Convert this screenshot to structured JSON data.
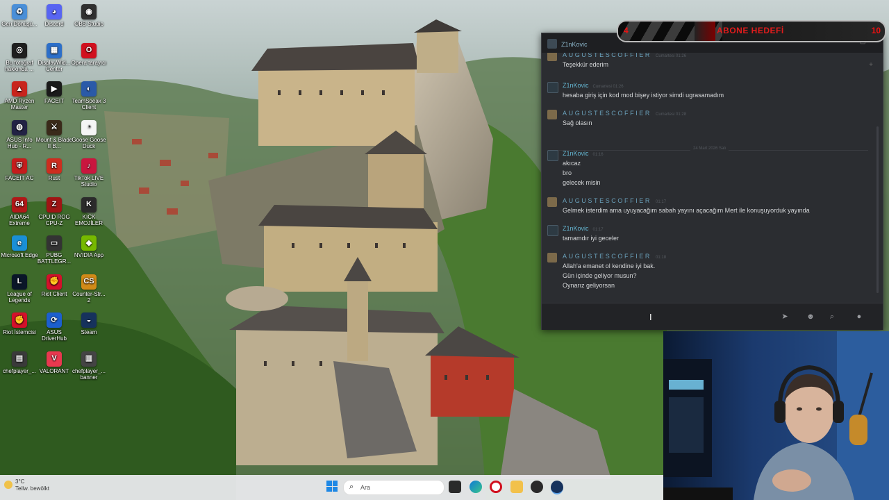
{
  "desktop": {
    "icons": [
      {
        "label": "Geri Dönüşü...",
        "color": "#4a8fd8",
        "glyph": "♻"
      },
      {
        "label": "Discord",
        "color": "#5865f2",
        "glyph": "◕"
      },
      {
        "label": "OBS Studio",
        "color": "#303030",
        "glyph": "◉"
      },
      {
        "label": "Bu fotoğraf hakkında ...",
        "color": "#1f1f1f",
        "glyph": "◎"
      },
      {
        "label": "DisplayWid... Center",
        "color": "#2d6fc9",
        "glyph": "▦"
      },
      {
        "label": "Opera tarayıcı",
        "color": "#d1101e",
        "glyph": "O"
      },
      {
        "label": "AMD Ryzen Master",
        "color": "#c8251d",
        "glyph": "▲"
      },
      {
        "label": "FACEIT",
        "color": "#1a1a1a",
        "glyph": "▶"
      },
      {
        "label": "TeamSpeak 3 Client",
        "color": "#2a5aa8",
        "glyph": "◐"
      },
      {
        "label": "ASUS Info Hub - R...",
        "color": "#222244",
        "glyph": "◍"
      },
      {
        "label": "Mount & Blade II B...",
        "color": "#3a2a1a",
        "glyph": "⚔"
      },
      {
        "label": "Goose Goose Duck",
        "color": "#f5f5f5",
        "glyph": "◔"
      },
      {
        "label": "FACEIT AC",
        "color": "#c51c1c",
        "glyph": "⛨"
      },
      {
        "label": "Rust",
        "color": "#cd2d1f",
        "glyph": "R"
      },
      {
        "label": "TikTok LIVE Studio",
        "color": "#c9163e",
        "glyph": "♪"
      },
      {
        "label": "AIDA64 Extreme",
        "color": "#b01818",
        "glyph": "64"
      },
      {
        "label": "CPUID ROG CPU-Z",
        "color": "#a01414",
        "glyph": "Z"
      },
      {
        "label": "KICK EMOJİLER",
        "color": "#2b2b2b",
        "glyph": "K"
      },
      {
        "label": "Microsoft Edge",
        "color": "#1a8fd6",
        "glyph": "e"
      },
      {
        "label": "PUBG BATTLEGR...",
        "color": "#333333",
        "glyph": "▭"
      },
      {
        "label": "NVIDIA App",
        "color": "#76b900",
        "glyph": "◆"
      },
      {
        "label": "League of Legends",
        "color": "#0a1628",
        "glyph": "L"
      },
      {
        "label": "Riot Client",
        "color": "#d3102a",
        "glyph": "✊"
      },
      {
        "label": "Counter-Str... 2",
        "color": "#d18a18",
        "glyph": "CS"
      },
      {
        "label": "Riot İstemcisi",
        "color": "#d3102a",
        "glyph": "✊"
      },
      {
        "label": "ASUS DriverHub",
        "color": "#1c5fcf",
        "glyph": "⟳"
      },
      {
        "label": "Steam",
        "color": "#16325c",
        "glyph": "◒"
      },
      {
        "label": "chefplayer_...",
        "color": "#3a3a3a",
        "glyph": "▤"
      },
      {
        "label": "VALORANT",
        "color": "#e8384f",
        "glyph": "V"
      },
      {
        "label": "chefplayer_... banner",
        "color": "#444444",
        "glyph": "▥"
      }
    ]
  },
  "taskbar": {
    "weather_temp": "3°C",
    "weather_desc": "Teilw. bewölkt",
    "search_placeholder": "Ara"
  },
  "chat": {
    "title": "Z1nKovic",
    "day_separator": "24 Mart 2026 Salı",
    "messages": [
      {
        "author": "AUGUSTESCOFFIER",
        "kind": "a",
        "time": "Cumartesi 01:26",
        "lines": [
          "Teşekkür ederim"
        ]
      },
      {
        "author": "Z1nKovic",
        "kind": "z",
        "time": "Cumartesi 01:26",
        "lines": [
          "hesaba giriş için kod mod bişey istiyor simdi ugrasamadım"
        ]
      },
      {
        "author": "AUGUSTESCOFFIER",
        "kind": "a",
        "time": "Cumartesi 01:28",
        "lines": [
          "Sağ olasın"
        ]
      },
      {
        "author": "Z1nKovic",
        "kind": "z",
        "time": "01:16",
        "lines": [
          "akıcaz",
          "bro",
          "gelecek misin"
        ]
      },
      {
        "author": "AUGUSTESCOFFIER",
        "kind": "a",
        "time": "01:17",
        "lines": [
          "Gelmek isterdim ama uyuyacağım sabah yayını açacağım Mert ile konuşuyorduk yayında"
        ]
      },
      {
        "author": "Z1nKovic",
        "kind": "z",
        "time": "01:17",
        "lines": [
          "tamamdır iyi geceler"
        ]
      },
      {
        "author": "AUGUSTESCOFFIER",
        "kind": "a",
        "time": "01:18",
        "lines": [
          "Allah'a emanet ol kendine iyi bak.",
          "Gün içinde geliyor musun?",
          "Oynarız geliyorsan"
        ]
      }
    ]
  },
  "goal": {
    "current": "4",
    "label": "ABONE HEDEFİ",
    "target": "10",
    "progress_fraction": 0.4
  }
}
